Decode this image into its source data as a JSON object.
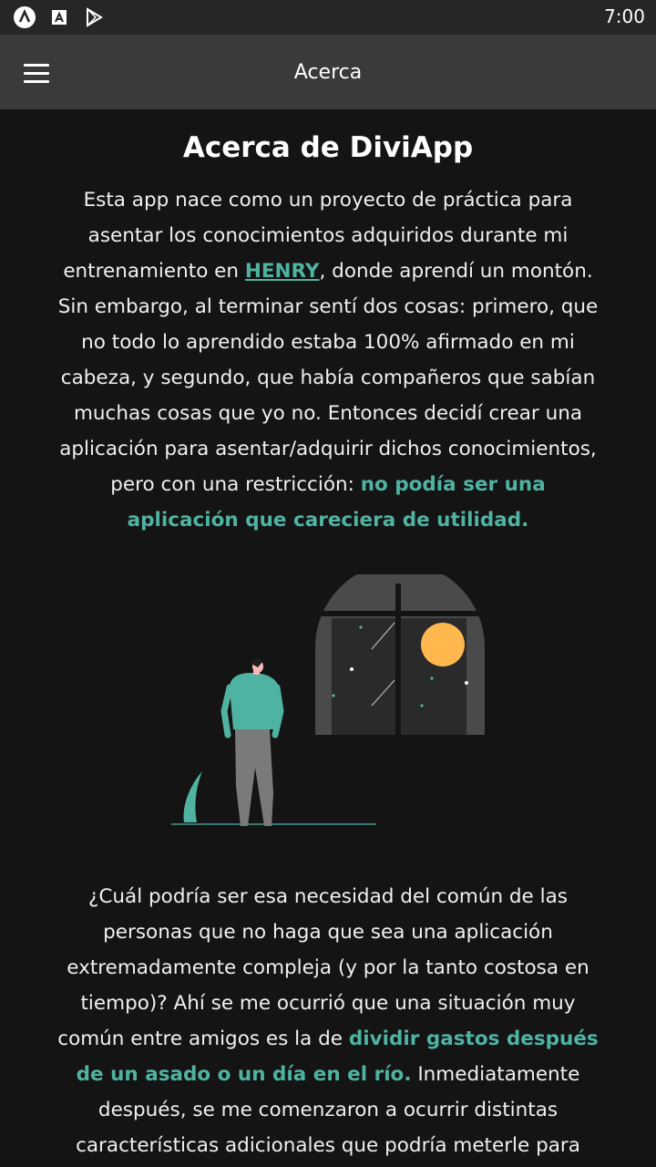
{
  "status_bar": {
    "time": "7:00",
    "icons": [
      "app-a-icon",
      "app-store-icon",
      "play-store-icon"
    ]
  },
  "app_bar": {
    "title": "Acerca",
    "menu_icon": "hamburger-menu-icon"
  },
  "about": {
    "heading": "Acerca de DiviApp",
    "p1_part1": "Esta app nace como un proyecto de práctica para asentar los conocimientos adquiridos durante mi entrenamiento en ",
    "p1_link": "HENRY",
    "p1_part2": ", donde aprendí un montón. Sin embargo, al terminar sentí dos cosas: primero, que no todo lo aprendido estaba 100% afirmado en mi cabeza, y segundo, que había compañeros que sabían muchas cosas que yo no. Entonces decidí crear una aplicación para asentar/adquirir dichos conocimientos, pero con una restricción: ",
    "p1_highlight": "no podía ser una aplicación que careciera de utilidad.",
    "p2_part1": "¿Cuál podría ser esa necesidad del común de las personas que no haga que sea una aplicación extremadamente compleja (y por la tanto costosa en tiempo)? Ahí se me ocurrió que una situación muy común entre amigos es la de ",
    "p2_highlight": "dividir gastos después de un asado o un día en el río.",
    "p2_part2": " Inmediatamente después, se me comenzaron a ocurrir distintas características adicionales que podría meterle para"
  },
  "colors": {
    "accent": "#4fb3a2",
    "background": "#141414",
    "app_bar": "#3a3a3a",
    "status_bar": "#262626",
    "moon": "#ffb84d",
    "window": "#4a4a4a"
  }
}
